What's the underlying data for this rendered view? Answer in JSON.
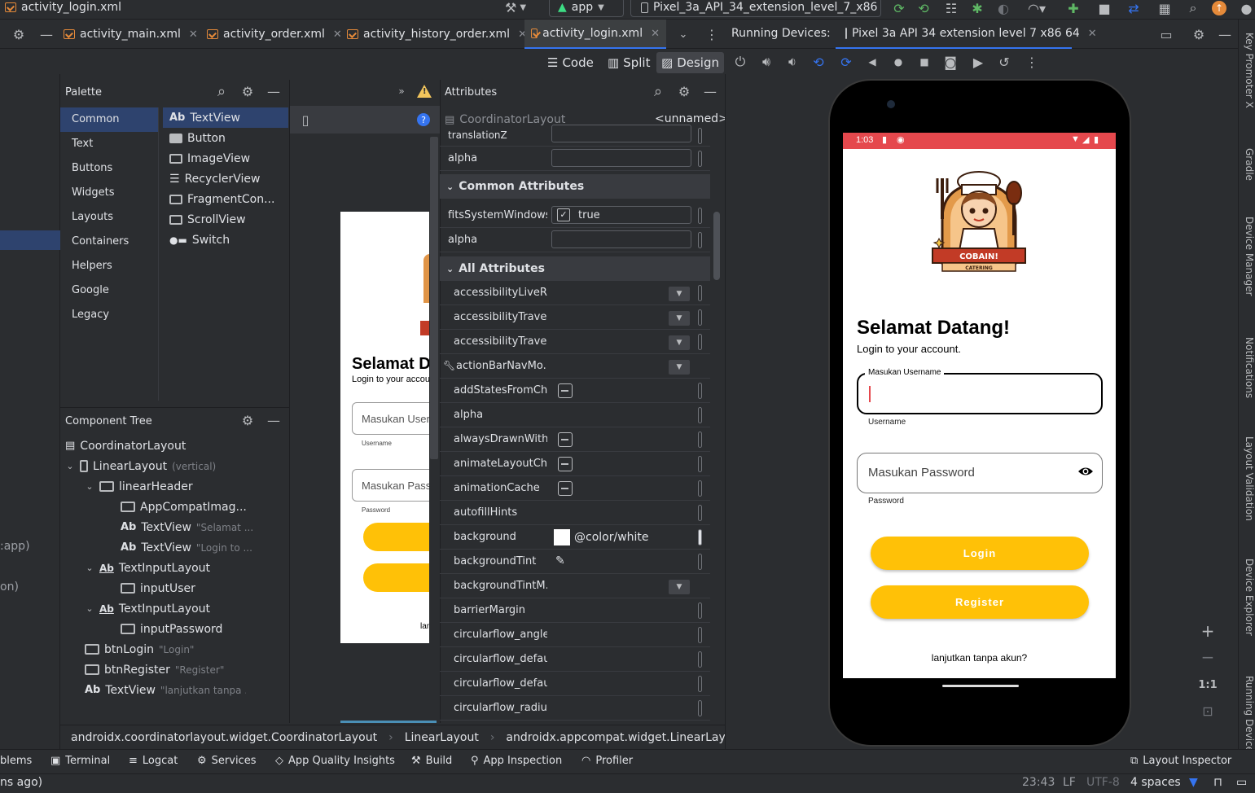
{
  "window": {
    "current_file": "activity_login.xml",
    "run_config": "app",
    "device_selector": "Pixel_3a_API_34_extension_level_7_x86"
  },
  "tabs": [
    {
      "label": "activity_main.xml"
    },
    {
      "label": "activity_order.xml"
    },
    {
      "label": "activity_history_order.xml"
    },
    {
      "label": "activity_login.xml"
    }
  ],
  "running_devices": {
    "label": "Running Devices:",
    "device": "Pixel 3a API 34 extension level 7 x86 64"
  },
  "view_modes": {
    "code": "Code",
    "split": "Split",
    "design": "Design"
  },
  "palette": {
    "title": "Palette",
    "categories": [
      "Common",
      "Text",
      "Buttons",
      "Widgets",
      "Layouts",
      "Containers",
      "Helpers",
      "Google",
      "Legacy"
    ],
    "items": [
      "TextView",
      "Button",
      "ImageView",
      "RecyclerView",
      "FragmentCon...",
      "ScrollView",
      "Switch"
    ],
    "textview_prefix": "Ab"
  },
  "left_edge": {
    "label1": ":app)",
    "label2": "on)"
  },
  "component_tree": {
    "title": "Component Tree",
    "nodes": [
      {
        "label": "CoordinatorLayout",
        "sub": ""
      },
      {
        "label": "LinearLayout",
        "sub": "(vertical)"
      },
      {
        "label": "linearHeader",
        "sub": ""
      },
      {
        "label": "AppCompatImag...",
        "sub": ""
      },
      {
        "label": "TextView",
        "sub": "\"Selamat ..."
      },
      {
        "label": "TextView",
        "sub": "\"Login to ..."
      },
      {
        "label": "TextInputLayout",
        "sub": ""
      },
      {
        "label": "inputUser",
        "sub": ""
      },
      {
        "label": "TextInputLayout",
        "sub": ""
      },
      {
        "label": "inputPassword",
        "sub": ""
      },
      {
        "label": "btnLogin",
        "sub": "\"Login\""
      },
      {
        "label": "btnRegister",
        "sub": "\"Register\""
      },
      {
        "label": "TextView",
        "sub": "\"lanjutkan tanpa ..."
      }
    ]
  },
  "attributes": {
    "title": "Attributes",
    "component": "CoordinatorLayout",
    "id": "<unnamed>",
    "top_rows": [
      "translationZ",
      "alpha"
    ],
    "common_section": "Common Attributes",
    "common_rows": [
      {
        "name": "fitsSystemWindows",
        "value": "true"
      },
      {
        "name": "alpha",
        "value": ""
      }
    ],
    "all_section": "All Attributes",
    "all_rows": [
      {
        "name": "accessibilityLiveRe...",
        "value": ""
      },
      {
        "name": "accessibilityTrave...",
        "value": ""
      },
      {
        "name": "accessibilityTrave...",
        "value": ""
      },
      {
        "name": "actionBarNavMo...",
        "value": ""
      },
      {
        "name": "addStatesFromCh...",
        "value": ""
      },
      {
        "name": "alpha",
        "value": ""
      },
      {
        "name": "alwaysDrawnWith...",
        "value": ""
      },
      {
        "name": "animateLayoutCh...",
        "value": ""
      },
      {
        "name": "animationCache",
        "value": ""
      },
      {
        "name": "autofillHints",
        "value": ""
      },
      {
        "name": "background",
        "value": "@color/white"
      },
      {
        "name": "backgroundTint",
        "value": ""
      },
      {
        "name": "backgroundTintM...",
        "value": ""
      },
      {
        "name": "barrierMargin",
        "value": ""
      },
      {
        "name": "circularflow_angles",
        "value": ""
      },
      {
        "name": "circularflow_defau...",
        "value": ""
      },
      {
        "name": "circularflow_defau...",
        "value": ""
      },
      {
        "name": "circularflow_radiu...",
        "value": ""
      }
    ]
  },
  "breadcrumb": [
    "androidx.coordinatorlayout.widget.CoordinatorLayout",
    "LinearLayout",
    "androidx.appcompat.widget.LinearLayoutCom"
  ],
  "design_preview": {
    "title": "Selamat Da",
    "subtitle": "Login to your accoun",
    "username_placeholder": "Masukan Userna",
    "username_helper": "Username",
    "password_placeholder": "Masukan Passw",
    "password_helper": "Password",
    "footer": "lanjut"
  },
  "phone": {
    "time": "1:03",
    "logo_text": "COBAIN!",
    "logo_sub": "CATERING",
    "title": "Selamat Datang!",
    "subtitle": "Login to your account.",
    "username_label": "Masukan Username",
    "username_helper": "Username",
    "password_placeholder": "Masukan Password",
    "password_helper": "Password",
    "login_button": "Login",
    "register_button": "Register",
    "footer_link": "lanjutkan tanpa akun?",
    "status_bar_color": "#e5484d",
    "button_color": "#ffc107"
  },
  "emulator_side": {
    "zoom_ratio": "1:1"
  },
  "right_tools": [
    "Key Promoter X",
    "Gradle",
    "Device Manager",
    "Notifications",
    "Layout Validation",
    "Device Explorer",
    "Running Devices"
  ],
  "status_bar": {
    "tools": [
      "blems",
      "Terminal",
      "Logcat",
      "Services",
      "App Quality Insights",
      "Build",
      "App Inspection",
      "Profiler"
    ],
    "layout_inspector": "Layout Inspector",
    "bottom_left": "ns ago)",
    "position": "23:43",
    "line_sep": "LF",
    "encoding": "UTF-8",
    "indent": "4 spaces"
  },
  "colors": {
    "accent": "#3574f0",
    "warning": "#f2c55c",
    "selection": "#2e436e"
  }
}
